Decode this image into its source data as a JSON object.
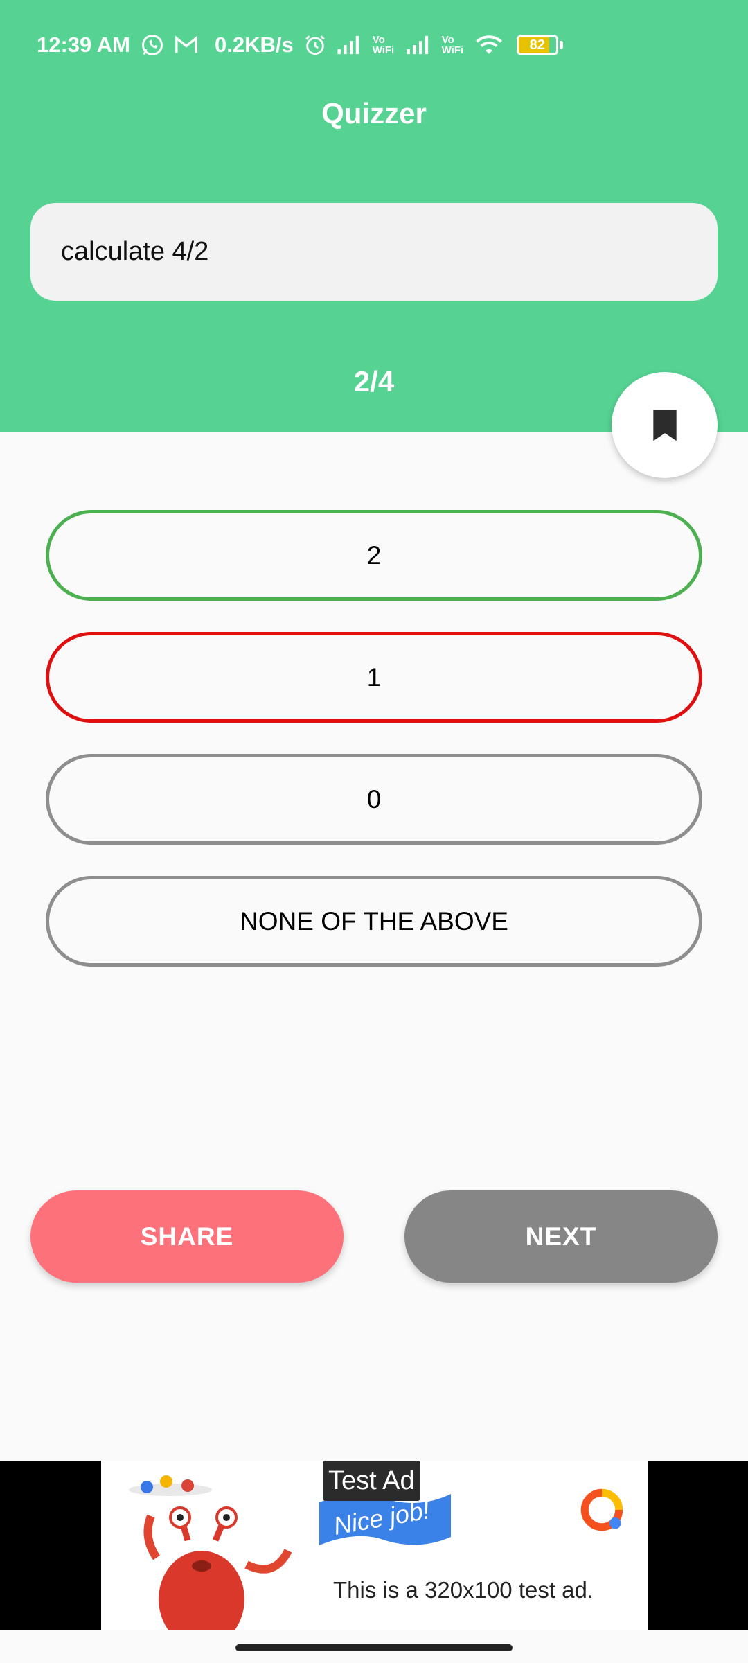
{
  "status_bar": {
    "time": "12:39 AM",
    "speed": "0.2KB/s",
    "battery": "82",
    "battery_level": 0.82,
    "icons": [
      "whatsapp-icon",
      "gmail-icon",
      "alarm-icon",
      "signal-icon",
      "vowifi-icon",
      "signal-icon",
      "vowifi-icon",
      "wifi-icon",
      "battery-icon"
    ],
    "vowifi_label": "Vo WiFi"
  },
  "app": {
    "title": "Quizzer"
  },
  "question": {
    "text": "calculate 4/2",
    "counter": "2/4"
  },
  "options": [
    {
      "label": "2",
      "state": "correct"
    },
    {
      "label": "1",
      "state": "wrong"
    },
    {
      "label": "0",
      "state": "default"
    },
    {
      "label": "NONE OF THE ABOVE",
      "state": "default"
    }
  ],
  "actions": {
    "share_label": "SHARE",
    "next_label": "NEXT"
  },
  "ad": {
    "label": "Test Ad",
    "banner_text": "Nice job!",
    "description": "This is a 320x100 test ad."
  },
  "colors": {
    "header": "#56d392",
    "correct": "#4caf50",
    "wrong": "#e01010",
    "share": "#fc717a",
    "next": "#868686"
  }
}
